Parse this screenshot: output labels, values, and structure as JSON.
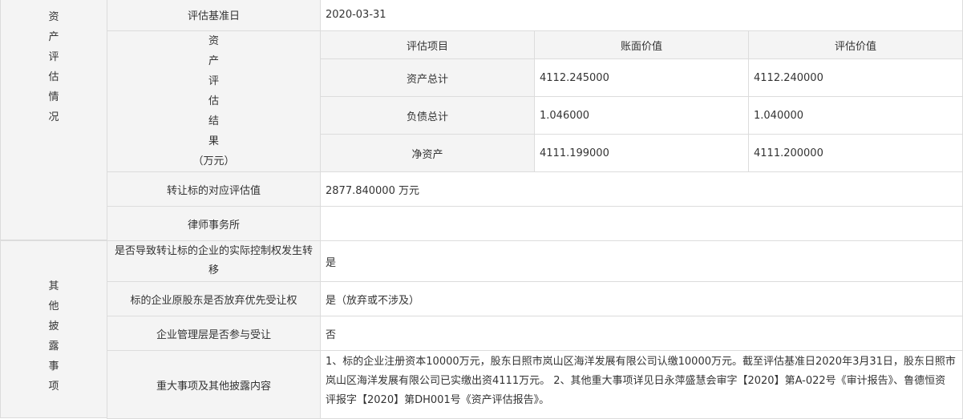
{
  "colors": {
    "label_bg": "#f4f4f4",
    "border": "#dcdcdc",
    "text": "#333333"
  },
  "section_asset": {
    "title_chars": [
      "资",
      "产",
      "评",
      "估",
      "情",
      "况"
    ],
    "base_date_label": "评估基准日",
    "base_date_value": "2020-03-31",
    "result_label_chars": [
      "资",
      "产",
      "评",
      "估",
      "结",
      "果",
      "（万元）"
    ],
    "table": {
      "headers": [
        "评估项目",
        "账面价值",
        "评估价值"
      ],
      "rows": [
        {
          "item": "资产总计",
          "book": "4112.245000",
          "appraised": "4112.240000"
        },
        {
          "item": "负债总计",
          "book": "1.046000",
          "appraised": "1.040000"
        },
        {
          "item": "净资产",
          "book": "4111.199000",
          "appraised": "4111.200000"
        }
      ]
    },
    "transfer_value_label": "转让标的对应评估值",
    "transfer_value": "2877.840000 万元",
    "law_firm_label": "律师事务所",
    "law_firm_value": ""
  },
  "section_other": {
    "title_chars": [
      "其",
      "他",
      "披",
      "露",
      "事",
      "项"
    ],
    "rows": [
      {
        "label": "是否导致转让标的企业的实际控制权发生转移",
        "value": "是"
      },
      {
        "label": "标的企业原股东是否放弃优先受让权",
        "value": "是（放弃或不涉及）"
      },
      {
        "label": "企业管理层是否参与受让",
        "value": "否"
      },
      {
        "label": "重大事项及其他披露内容",
        "value": "1、标的企业注册资本10000万元，股东日照市岚山区海洋发展有限公司认缴10000万元。截至评估基准日2020年3月31日，股东日照市岚山区海洋发展有限公司已实缴出资4111万元。 2、其他重大事项详见日永萍盛慧会审字【2020】第A-022号《审计报告》、鲁德恒资评报字【2020】第DH001号《资产评估报告》。"
      }
    ]
  }
}
